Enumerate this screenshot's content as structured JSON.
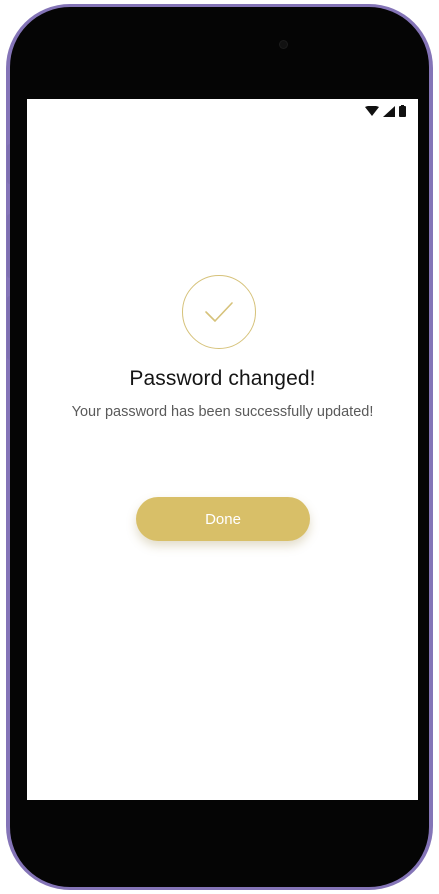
{
  "status_bar": {
    "icons": [
      "wifi-icon",
      "cellular-signal-icon",
      "battery-icon"
    ]
  },
  "success": {
    "icon": "checkmark-circle-icon",
    "title": "Password changed!",
    "message": "Your password has been successfully updated!",
    "button_label": "Done"
  },
  "colors": {
    "accent": "#d8bf68",
    "accent_outline": "#d6c27a",
    "frame": "#8474b7",
    "title_text": "#151515",
    "body_text": "#5a5a5a"
  }
}
